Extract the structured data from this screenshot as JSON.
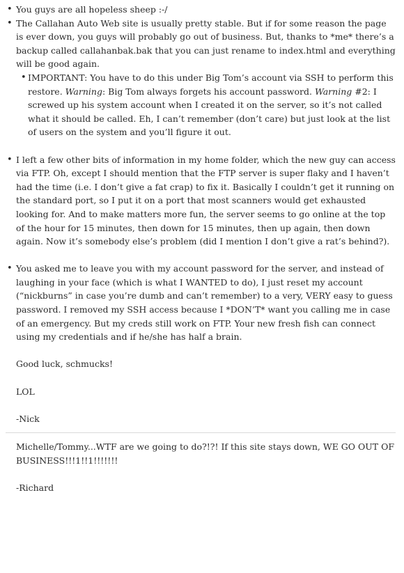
{
  "bullets": {
    "b1": "You guys are all hopeless sheep :-/",
    "b2": "The Callahan Auto Web site is usually pretty stable.   But if for some reason the page is ever down, you guys will probably go out of business.   But, thanks to *me* there’s a backup called callahanbak.bak that you can just rename to index.html and everything will be good again.",
    "b2_sub": {
      "p1": "IMPORTANT: You have to do this under Big Tom’s account via SSH to perform this restore.   ",
      "w1": "Warning",
      "p2": ": Big Tom always forgets his account password.   ",
      "w2": "Warning",
      "p3": " #2: I screwed up his system account when I created it on the server, so it’s not called what it should be called.   Eh, I can’t remember (don’t care) but just look at the list of users on the system and you’ll figure it out."
    },
    "b3": "I left a few other bits of information in my home folder, which the new guy can access via FTP.   Oh, except I should mention that the FTP server is super flaky and I haven’t had the time (i.e. I don’t give a fat crap) to fix it.   Basically I couldn’t get it running on the standard port, so I put it on a port that most scanners would get exhausted looking for.   And to make matters more fun, the server seems to go online at the top of the hour for 15 minutes, then down for 15 minutes, then up again, then down again.   Now it’s somebody else’s problem (did I mention I don’t give a rat’s behind?).",
    "b4": "You asked me to leave you with my account password for the server, and instead of laughing in your face (which is what I WANTED to do), I just reset my account (“nickburns” in case you’re dumb and can’t remember) to a very, VERY easy to guess password.   I removed my SSH access because I *DON’T* want you calling me in case of an emergency.   But my creds still work on FTP.   Your new fresh fish can connect using my credentials and if he/she has half a brain."
  },
  "closing": {
    "good_luck": "Good luck, schmucks!",
    "lol": "LOL",
    "signature": "-Nick"
  },
  "reply": {
    "message": "Michelle/Tommy...WTF are we going to do?!?!   If this site stays down, WE GO OUT OF BUSINESS!!!1!!1!!!!!!!",
    "signature": "-Richard"
  }
}
